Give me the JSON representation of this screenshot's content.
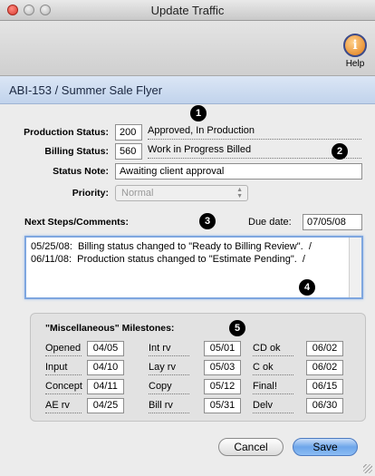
{
  "window": {
    "title": "Update Traffic"
  },
  "toolbar": {
    "help_label": "Help",
    "help_icon_glyph": "i"
  },
  "record": {
    "title": "ABI-153 / Summer Sale Flyer"
  },
  "callouts": [
    "1",
    "2",
    "3",
    "4",
    "5"
  ],
  "production_status": {
    "label": "Production Status:",
    "code": "200",
    "description": "Approved, In Production"
  },
  "billing_status": {
    "label": "Billing Status:",
    "code": "560",
    "description": "Work in Progress Billed"
  },
  "status_note": {
    "label": "Status Note:",
    "value": "Awaiting client approval"
  },
  "priority": {
    "label": "Priority:",
    "value": "Normal"
  },
  "next_steps": {
    "label": "Next Steps/Comments:",
    "due_label": "Due date:",
    "due_value": "07/05/08",
    "lines": [
      "05/25/08:  Billing status changed to \"Ready to Billing Review\".  /",
      "06/11/08:  Production status changed to \"Estimate Pending\".  /"
    ]
  },
  "milestones": {
    "title": "\"Miscellaneous\" Milestones:",
    "columns": [
      [
        {
          "label": "Opened",
          "value": "04/05"
        },
        {
          "label": "Input",
          "value": "04/10"
        },
        {
          "label": "Concept",
          "value": "04/11"
        },
        {
          "label": "AE rv",
          "value": "04/25"
        }
      ],
      [
        {
          "label": "Int rv",
          "value": "05/01"
        },
        {
          "label": "Lay rv",
          "value": "05/03"
        },
        {
          "label": "Copy",
          "value": "05/12"
        },
        {
          "label": "Bill rv",
          "value": "05/31"
        }
      ],
      [
        {
          "label": "CD ok",
          "value": "06/02"
        },
        {
          "label": "C ok",
          "value": "06/02"
        },
        {
          "label": "Final!",
          "value": "06/15"
        },
        {
          "label": "Delv",
          "value": "06/30"
        }
      ]
    ]
  },
  "buttons": {
    "cancel": "Cancel",
    "save": "Save"
  }
}
